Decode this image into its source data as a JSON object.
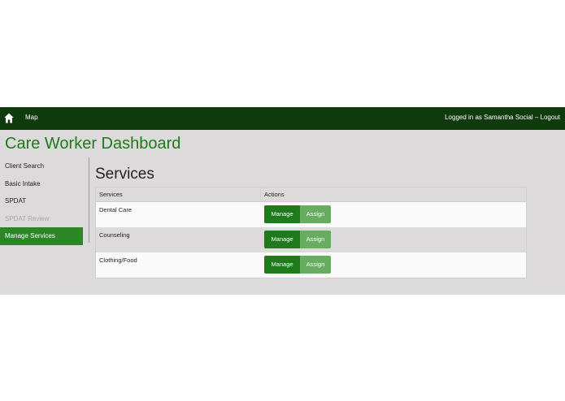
{
  "topbar": {
    "home_icon": "home-icon",
    "map_label": "Map",
    "session_text": "Logged in as Samantha Social",
    "separator": " – ",
    "logout_label": "Logout"
  },
  "app_title": "Care Worker Dashboard",
  "sidebar": {
    "items": [
      {
        "label": "Client Search",
        "state": "normal"
      },
      {
        "label": "Basic Intake",
        "state": "normal"
      },
      {
        "label": "SPDAT",
        "state": "normal"
      },
      {
        "label": "SPDAT Review",
        "state": "disabled"
      },
      {
        "label": "Manage Services",
        "state": "active"
      }
    ]
  },
  "main": {
    "title": "Services",
    "table": {
      "headers": [
        "Services",
        "Actions"
      ],
      "rows": [
        {
          "service": "Dental Care",
          "manage": "Manage",
          "assign": "Assign"
        },
        {
          "service": "Counseling",
          "manage": "Manage",
          "assign": "Assign"
        },
        {
          "service": "Clothing/Food",
          "manage": "Manage",
          "assign": "Assign"
        }
      ]
    }
  },
  "colors": {
    "topbar": "#0e3a0c",
    "brand_green": "#1e7a1a",
    "active_nav": "#2c8526",
    "assign_button": "#67ad5f",
    "panel_bg": "#dcdadb"
  }
}
